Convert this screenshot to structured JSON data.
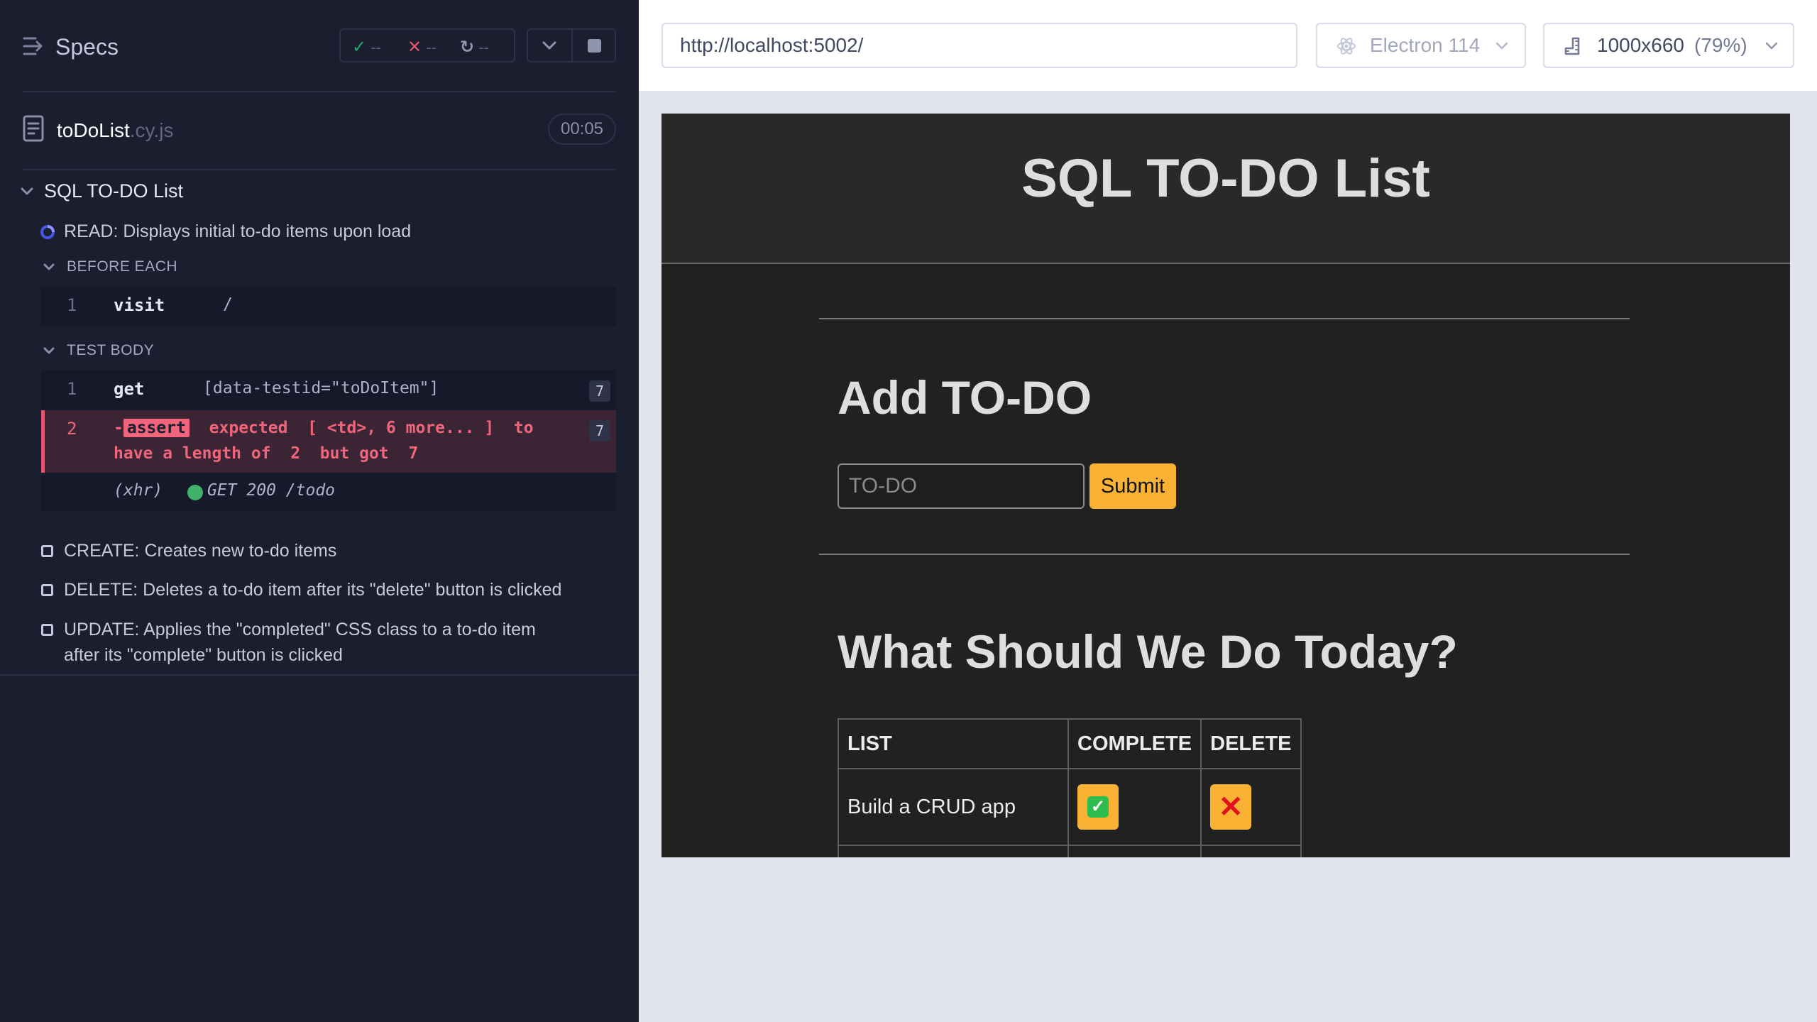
{
  "reporter": {
    "title": "Specs",
    "stats": {
      "passed": "--",
      "failed": "--",
      "pending": "--"
    },
    "spec": {
      "name": "toDoList",
      "ext": ".cy.js",
      "duration": "00:05"
    },
    "suite": {
      "title": "SQL TO-DO List"
    },
    "tests": {
      "read": "READ: Displays initial to-do items upon load",
      "create": "CREATE: Creates new to-do items",
      "delete": "DELETE: Deletes a to-do item after its \"delete\" button is clicked",
      "update_line1": "UPDATE: Applies the \"completed\" CSS class to a to-do item",
      "update_line2": "after its \"complete\" button is clicked"
    },
    "hooks": {
      "before_each": "BEFORE EACH",
      "test_body": "TEST BODY"
    },
    "commands": {
      "visit": {
        "num": "1",
        "name": "visit",
        "msg": "/"
      },
      "get": {
        "num": "1",
        "name": "get",
        "msg": "[data-testid=\"toDoItem\"]",
        "count": "7"
      },
      "assert": {
        "num": "2",
        "dash": "-",
        "tag": "assert",
        "line1": "expected  [ <td>, 6 more... ]  to",
        "line2": "have a length of  2  but got  7",
        "count": "7"
      },
      "xhr": {
        "label": "(xhr)",
        "msg": "GET 200 /todo"
      }
    },
    "colors": {
      "fail": "#f0657c",
      "pass": "#1fa971",
      "running": "#4956e3",
      "xhr_dot": "#3fb26b"
    }
  },
  "browser": {
    "url": "http://localhost:5002/",
    "browser_label": "Electron 114",
    "viewport_size": "1000x660",
    "viewport_pct": "(79%)"
  },
  "app": {
    "title": "SQL TO-DO List",
    "add_heading": "Add TO-DO",
    "input_placeholder": "TO-DO",
    "submit_label": "Submit",
    "list_heading": "What Should We Do Today?",
    "table": {
      "headers": [
        "LIST",
        "COMPLETE",
        "DELETE"
      ],
      "rows": [
        {
          "item": "Build a CRUD app"
        }
      ]
    },
    "colors": {
      "accent": "#f9b234",
      "check": "#2ebd4c",
      "delete": "#e0121d"
    }
  }
}
